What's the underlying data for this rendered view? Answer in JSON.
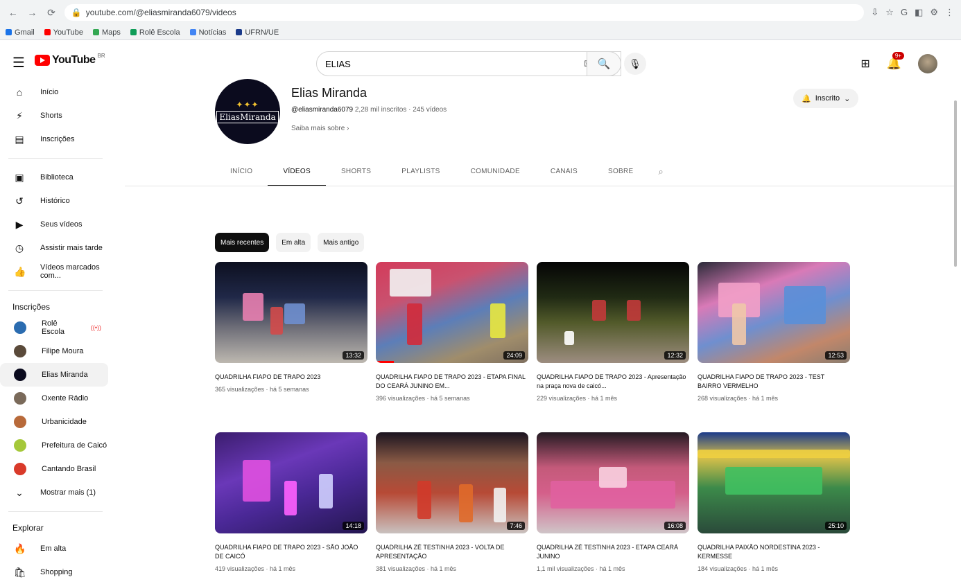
{
  "browser": {
    "url": "youtube.com/@eliasmiranda6079/videos",
    "nav": [
      "←",
      "→",
      "⟳"
    ],
    "extensions": [
      "⇩",
      "☆",
      "G",
      "◧",
      "⚙",
      "⋮"
    ],
    "bookmarks": [
      {
        "label": "Gmail",
        "color": "#1a73e8"
      },
      {
        "label": "YouTube",
        "color": "#ff0000"
      },
      {
        "label": "Maps",
        "color": "#34a853"
      },
      {
        "label": "Rolê Escola",
        "color": "#0f9d58"
      },
      {
        "label": "Notícias",
        "color": "#4285f4"
      },
      {
        "label": "UFRN/UE",
        "color": "#1a3a8a"
      }
    ]
  },
  "topbar": {
    "logo_text": "YouTube",
    "logo_cc": "BR",
    "search_value": "ELIAS",
    "keyboard_icon": "⌨",
    "notification_count": "9+"
  },
  "sidebar": {
    "main": [
      {
        "label": "Início",
        "icon": "⌂"
      },
      {
        "label": "Shorts",
        "icon": "⚡"
      },
      {
        "label": "Inscrições",
        "icon": "▤"
      }
    ],
    "library": [
      {
        "label": "Biblioteca",
        "icon": "▣"
      },
      {
        "label": "Histórico",
        "icon": "↺"
      },
      {
        "label": "Seus vídeos",
        "icon": "▶"
      },
      {
        "label": "Assistir mais tarde",
        "icon": "◷"
      },
      {
        "label": "Vídeos marcados com...",
        "icon": "👍"
      }
    ],
    "subscriptions_heading": "Inscrições",
    "subscriptions": [
      {
        "label": "Rolê Escola",
        "color": "#2b6cb0",
        "live": true
      },
      {
        "label": "Filipe Moura",
        "color": "#5a4a3a",
        "live": false
      },
      {
        "label": "Elias Miranda",
        "color": "#0b0b1e",
        "live": false
      },
      {
        "label": "Oxente Rádio",
        "color": "#7a6a5a",
        "live": false
      },
      {
        "label": "Urbanicidade",
        "color": "#b86a3a",
        "live": false
      },
      {
        "label": "Prefeitura de Caicó",
        "color": "#a5c83a",
        "live": false
      },
      {
        "label": "Cantando Brasil",
        "color": "#d93a2a",
        "live": false
      }
    ],
    "show_more": "Mostrar mais (1)",
    "explore_heading": "Explorar",
    "explore": [
      {
        "label": "Em alta",
        "icon": "🔥"
      },
      {
        "label": "Shopping",
        "icon": "🛍"
      }
    ]
  },
  "channel": {
    "avatar_text": "EliasMiranda",
    "name": "Elias Miranda",
    "handle": "@eliasmiranda6079",
    "meta": "2,28 mil inscritos · 245 vídeos",
    "more": "Saiba mais sobre",
    "subscribe_label": "Inscrito"
  },
  "tabs": [
    "INÍCIO",
    "VÍDEOS",
    "SHORTS",
    "PLAYLISTS",
    "COMUNIDADE",
    "CANAIS",
    "SOBRE"
  ],
  "active_tab": 1,
  "chips": [
    "Mais recentes",
    "Em alta",
    "Mais antigo"
  ],
  "selected_chip": 0,
  "videos": [
    {
      "title": "QUADRILHA FIAPO DE TRAPO 2023",
      "meta": "365 visualizações · há 5 semanas",
      "duration": "13:32",
      "progress": 0
    },
    {
      "title": "QUADRILHA FIAPO DE TRAPO 2023 - ETAPA FINAL DO CEARÁ JUNINO EM...",
      "meta": "396 visualizações · há 5 semanas",
      "duration": "24:09",
      "progress": 0.12
    },
    {
      "title": "QUADRILHA FIAPO DE TRAPO 2023 - Apresentação na praça nova de caicó...",
      "meta": "229 visualizações · há 1 mês",
      "duration": "12:32",
      "progress": 0
    },
    {
      "title": "QUADRILHA FIAPO DE TRAPO 2023 - TEST BAIRRO VERMELHO",
      "meta": "268 visualizações · há 1 mês",
      "duration": "12:53",
      "progress": 0
    },
    {
      "title": "QUADRILHA FIAPO DE TRAPO 2023 - SÃO JOÃO DE CAICÓ",
      "meta": "419 visualizações · há 1 mês",
      "duration": "14:18",
      "progress": 0
    },
    {
      "title": "QUADRILHA ZÉ TESTINHA 2023 - VOLTA DE APRESENTAÇÃO",
      "meta": "381 visualizações · há 1 mês",
      "duration": "7:46",
      "progress": 0
    },
    {
      "title": "QUADRILHA ZÉ TESTINHA 2023 - ETAPA CEARÁ JUNINO",
      "meta": "1,1 mil visualizações · há 1 mês",
      "duration": "16:08",
      "progress": 0
    },
    {
      "title": "QUADRILHA PAIXÃO NORDESTINA 2023 - KERMESSE",
      "meta": "184 visualizações · há 1 mês",
      "duration": "25:10",
      "progress": 0
    }
  ]
}
